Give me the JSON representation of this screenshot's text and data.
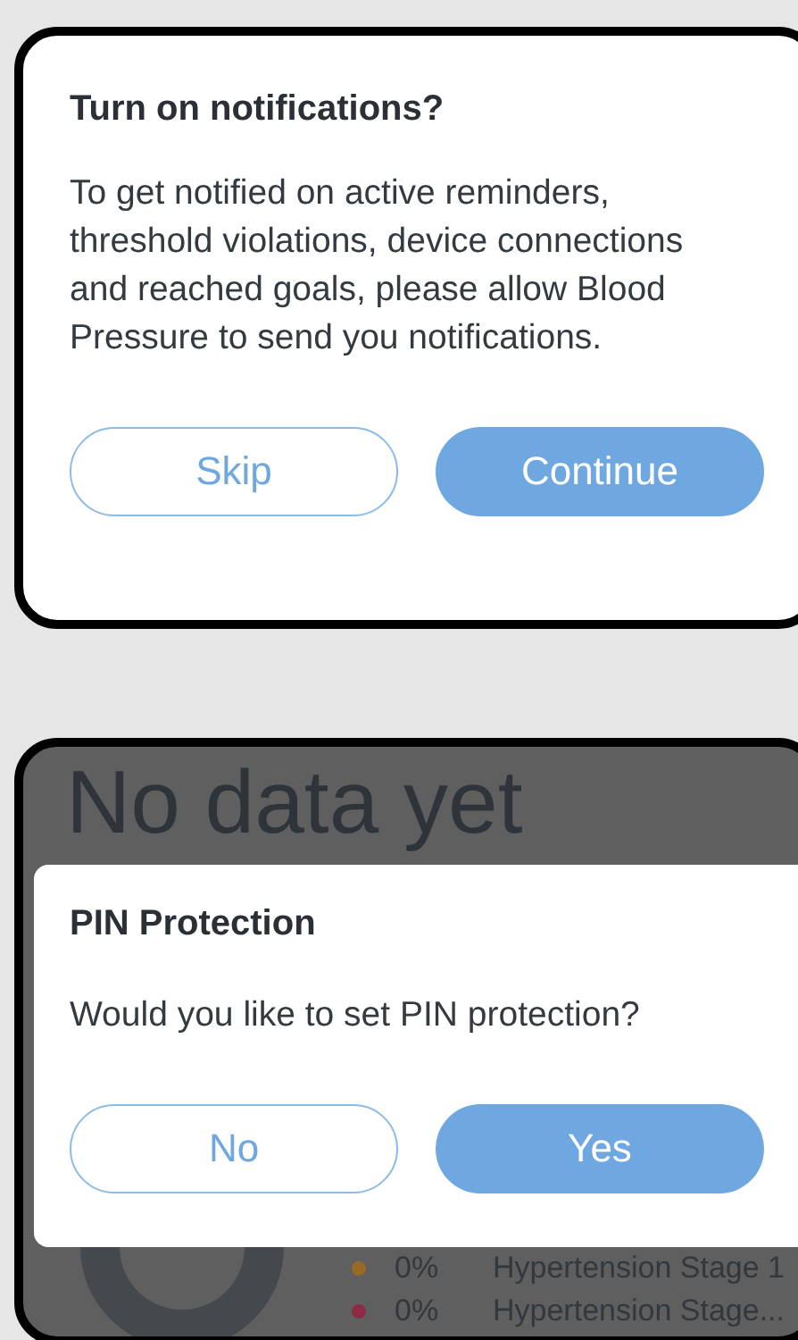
{
  "notification_dialog": {
    "title": "Turn on notifications?",
    "message": "To get notified on active reminders, threshold violations, device connections and reached goals, please allow Blood Pressure to send you notifications.",
    "buttons": [
      {
        "label": "Skip",
        "kind": "outline"
      },
      {
        "label": "Continue",
        "kind": "filled"
      }
    ]
  },
  "background_screen": {
    "heading": "No data yet",
    "legend": [
      {
        "percent": "0%",
        "label": "Hypertension Stage 1",
        "color": "#9a6a25"
      },
      {
        "percent": "0%",
        "label": "Hypertension Stage...",
        "color": "#8e2a45"
      }
    ]
  },
  "pin_dialog": {
    "title": "PIN Protection",
    "message": "Would you like to set PIN protection?",
    "buttons": [
      {
        "label": "No",
        "kind": "outline"
      },
      {
        "label": "Yes",
        "kind": "filled"
      }
    ]
  }
}
